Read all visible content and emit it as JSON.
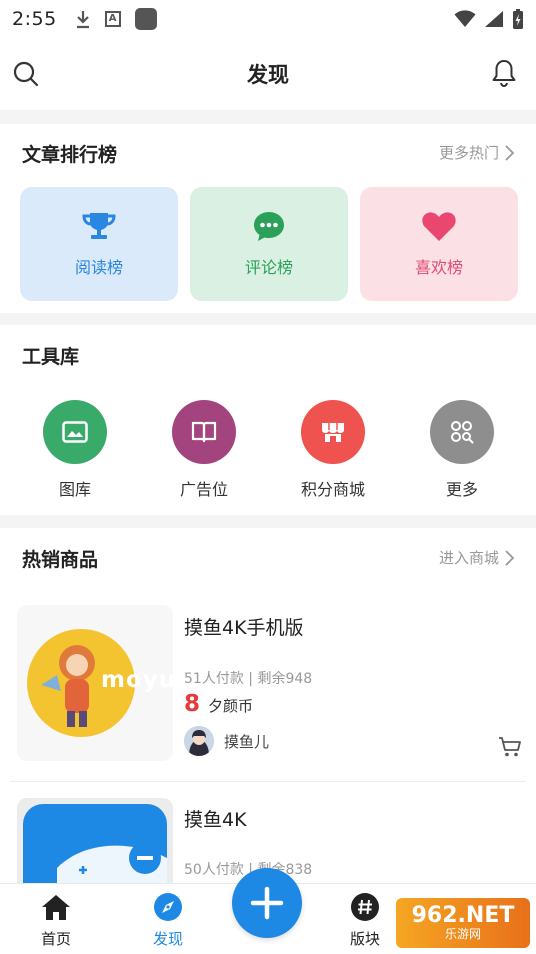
{
  "status_bar": {
    "time": "2:55",
    "icons": [
      "download-icon",
      "font-icon",
      "app-square-icon",
      "wifi-icon",
      "signal-icon",
      "battery-charging-icon"
    ]
  },
  "header": {
    "title": "发现",
    "left_icon": "search-icon",
    "right_icon": "bell-icon"
  },
  "ranking": {
    "title": "文章排行榜",
    "more": "更多热门",
    "cards": [
      {
        "label": "阅读榜",
        "icon": "trophy-icon",
        "color": "#2a86e0"
      },
      {
        "label": "评论榜",
        "icon": "chat-bubble-icon",
        "color": "#2aa058"
      },
      {
        "label": "喜欢榜",
        "icon": "heart-icon",
        "color": "#e04c72"
      }
    ]
  },
  "tools": {
    "title": "工具库",
    "items": [
      {
        "label": "图库",
        "icon": "image-icon",
        "color": "#3aaa6a"
      },
      {
        "label": "广告位",
        "icon": "book-icon",
        "color": "#a4447f"
      },
      {
        "label": "积分商城",
        "icon": "shop-icon",
        "color": "#ef5350"
      },
      {
        "label": "更多",
        "icon": "more-grid-icon",
        "color": "#8e8e8e"
      }
    ]
  },
  "products": {
    "title": "热销商品",
    "more": "进入商城",
    "items": [
      {
        "name": "摸鱼4K手机版",
        "sales": "51人付款",
        "stock": "剩余948",
        "price": "8",
        "unit": "夕颜币",
        "seller": "摸鱼儿",
        "thumb_text": "moyu"
      },
      {
        "name": "摸鱼4K",
        "sales": "50人付款",
        "stock": "剩余838"
      }
    ]
  },
  "bottom_nav": {
    "items": [
      {
        "label": "首页",
        "icon": "home-icon"
      },
      {
        "label": "发现",
        "icon": "compass-icon",
        "active": true
      },
      {
        "label": "版块",
        "icon": "hashtag-icon"
      }
    ],
    "fab_icon": "plus-icon"
  },
  "watermark": {
    "big": "962.NET",
    "small": "乐游网"
  }
}
